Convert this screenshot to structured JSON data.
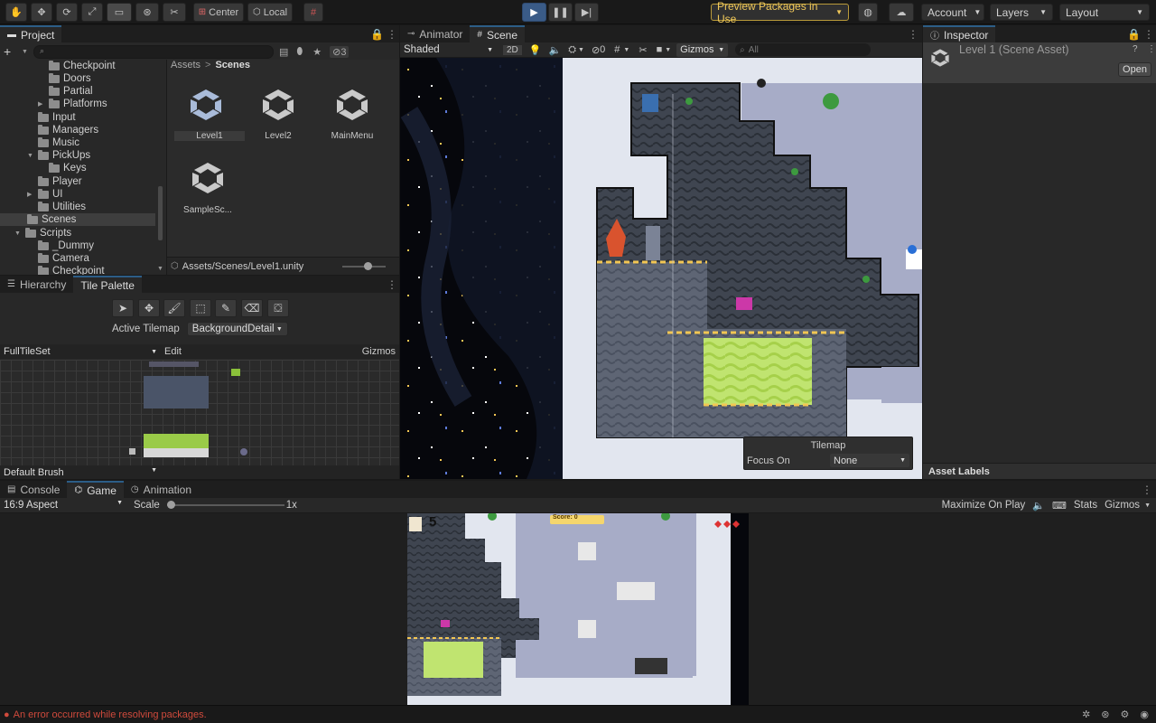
{
  "toolbar": {
    "pivot_center": "Center",
    "pivot_local": "Local",
    "preview_packages": "Preview Packages in Use",
    "account": "Account",
    "layers": "Layers",
    "layout": "Layout"
  },
  "project": {
    "tab": "Project",
    "add_label": "+",
    "layer_count": "3",
    "tree": [
      "Checkpoint",
      "Doors",
      "Partial",
      "Platforms",
      "Input",
      "Managers",
      "Music",
      "PickUps",
      "Keys",
      "Player",
      "UI",
      "Utilities",
      "Scenes",
      "Scripts",
      "_Dummy",
      "Camera",
      "Checkpoint"
    ],
    "breadcrumb_root": "Assets",
    "breadcrumb_sep": ">",
    "breadcrumb_current": "Scenes",
    "assets": [
      "Level1",
      "Level2",
      "MainMenu",
      "SampleSc..."
    ],
    "path": "Assets/Scenes/Level1.unity"
  },
  "palette": {
    "tab_hierarchy": "Hierarchy",
    "tab_palette": "Tile Palette",
    "active_tilemap_label": "Active Tilemap",
    "active_tilemap_value": "BackgroundDetail",
    "palette_name": "FullTileSet",
    "edit": "Edit",
    "gizmos": "Gizmos",
    "brush": "Default Brush"
  },
  "scene": {
    "tab_animator": "Animator",
    "tab_scene": "Scene",
    "shading": "Shaded",
    "mode_2d": "2D",
    "hidden_count": "0",
    "gizmos": "Gizmos",
    "search_placeholder": "All",
    "overlay_title": "Tilemap",
    "focus_label": "Focus On",
    "focus_value": "None"
  },
  "inspector": {
    "tab": "Inspector",
    "title": "Level 1 (Scene Asset)",
    "open_button": "Open",
    "asset_labels": "Asset Labels"
  },
  "game": {
    "tab_console": "Console",
    "tab_game": "Game",
    "tab_animation": "Animation",
    "aspect": "16:9 Aspect",
    "scale_label": "Scale",
    "scale_value": "1x",
    "maximize": "Maximize On Play",
    "stats": "Stats",
    "gizmos": "Gizmos",
    "hud_lives": "5",
    "hud_score": "Score: 0"
  },
  "status": {
    "error": "An error occurred while resolving packages."
  },
  "colors": {
    "accent": "#2c5d87",
    "play_active": "#3a5b87",
    "preview_text": "#f0c85a",
    "error": "#d04a3c"
  }
}
